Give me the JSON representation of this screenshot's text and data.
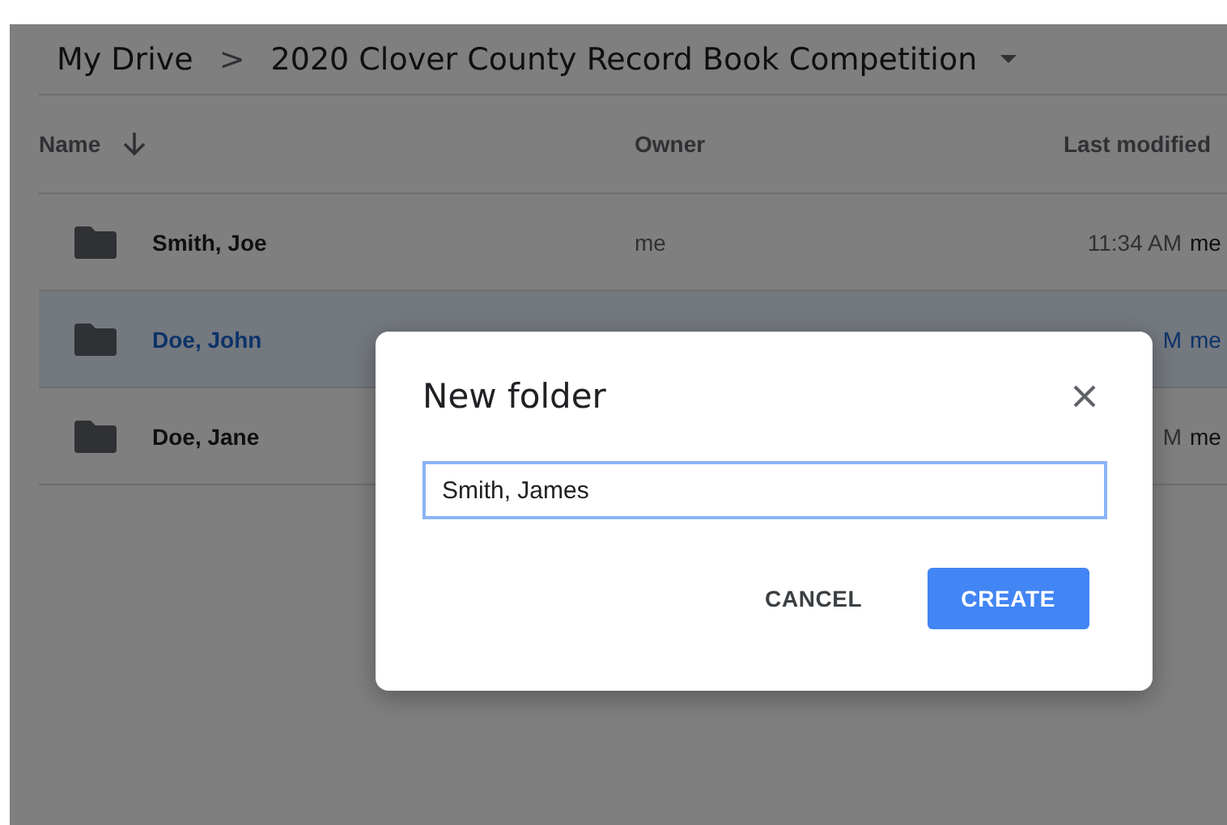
{
  "breadcrumb": {
    "root": "My Drive",
    "separator": ">",
    "current": "2020 Clover County Record Book Competition"
  },
  "columns": {
    "name": "Name",
    "owner": "Owner",
    "modified": "Last modified"
  },
  "rows": [
    {
      "name": "Smith, Joe",
      "owner": "me",
      "modified": "11:34 AM",
      "modified_by": "me",
      "selected": false
    },
    {
      "name": "Doe, John",
      "modified": "M",
      "modified_by": "me",
      "selected": true
    },
    {
      "name": "Doe, Jane",
      "modified": "M",
      "modified_by": "me",
      "selected": false
    }
  ],
  "dialog": {
    "title": "New folder",
    "value": "Smith, James",
    "buttons": [
      {
        "label": "CANCEL",
        "kind": "text"
      },
      {
        "label": "CREATE",
        "kind": "primary"
      }
    ]
  }
}
